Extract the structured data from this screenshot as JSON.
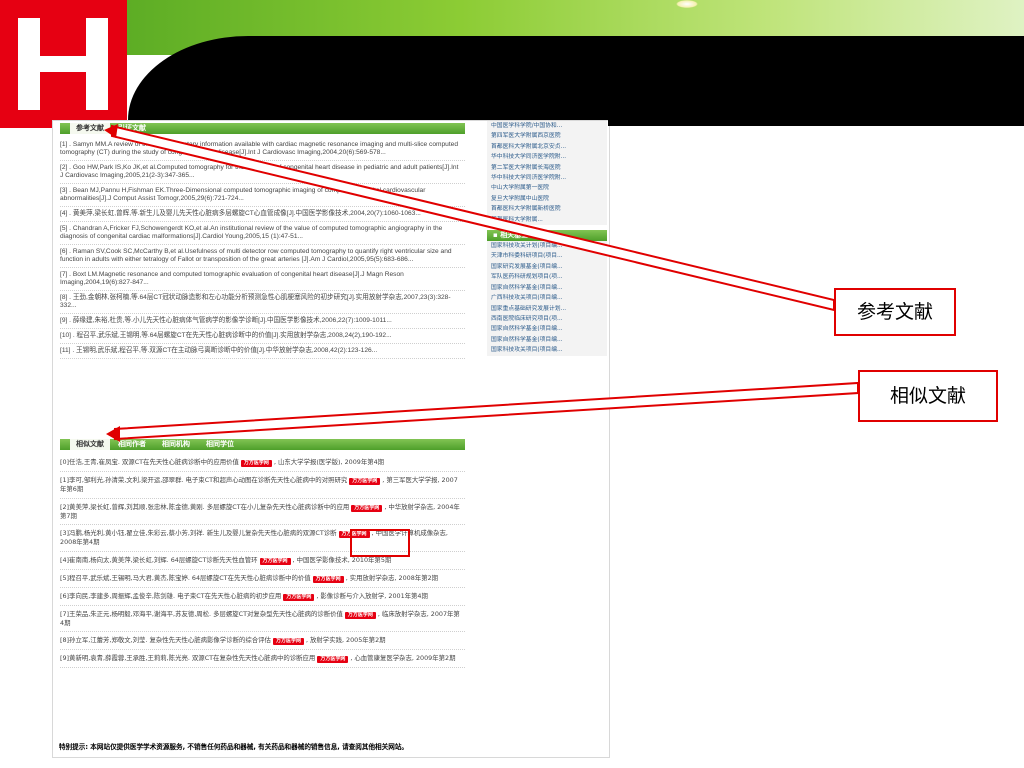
{
  "callouts": {
    "references": "参考文献",
    "similar": "相似文献"
  },
  "tabs_top": {
    "active": "参考文献",
    "other": "引证文献"
  },
  "tabs_bottom": {
    "active": "相似文献",
    "second": "相同作者",
    "third": "相同机构",
    "fourth": "相同学位"
  },
  "references": [
    "[1] . Samyn MM.A review of the complementary information available with cardiac magnetic resonance imaging and multi-slice computed tomography (CT) during the study of congenital heart disease[J].Int J Cardiovasc Imaging,2004,20(6):569-578...",
    "[2] . Goo HW,Park IS,Ko JK,et al.Computed tomography for the diagnosis of congenital heart disease in pediatric and adult patients[J].Int J Cardiovasc Imaging,2005,21(2-3):347-365...",
    "[3] . Bean MJ,Pannu H,Fishman EK.Three-Dimensional computed tomographic imaging of complex congenital cardiovascular abnormalities[J].J Comput Assist Tomogr,2005,29(6):721-724...",
    "[4] . 黄美萍,梁长虹,曾辉,等.新生儿及婴儿先天性心脏病多层螺旋CT心血管成像[J].中国医学影像技术,2004,20(7):1060-1063...",
    "[5] . Chandran A,Fricker FJ,Schowengerdt KO,et al.An institutional review of the value of computed tomographic angiography in the diagnosis of congenital cardiac malformations[J].Cardiol Young,2005,15 (1):47-51...",
    "[6] . Raman SV,Cook SC,McCarthy B,et al.Usefulness of multi detector row computed tomography to quantify right ventricular size and function in adults with either tetralogy of Fallot or transposition of the great arteries [J].Am J Cardiol,2005,95(5):683-686...",
    "[7] . Boxt LM.Magnetic resonance and computed tomographic evaluation of congenital heart disease[J].J Magn Reson Imaging,2004,19(6):827-847...",
    "[8] . 王劲,金朝林,张柯楠,等.64层CT冠状动脉造影和左心功能分析预测急性心肌梗塞风险的初步研究[J].实用放射学杂志,2007,23(3):328-332...",
    "[9] . 薛缘建,朱裕,杜贵,等.小儿先天性心脏病体气管病学的影像学诊断[J].中国医学影像技术,2006,22(7):1009-1011...",
    "[10] . 程召平,武乐斌,王锡明,等.64层螺旋CT在先天性心脏病诊断中的价值[J].实用放射学杂志,2008,24(2),190-192...",
    "[11] . 王锡明,武乐斌,程召平,等.双源CT在主动脉弓离断诊断中的价值[J].中华放射学杂志,2008,42(2):123-126..."
  ],
  "similar": [
    {
      "text": "[0]任浩,王青,崔凤宝. 双源CT在先天性心脏病诊断中的应用价值",
      "tail": ", 山东大学学报(医学版), 2009年第4期"
    },
    {
      "text": "[1]李可,邹利光,孙清荣,文利,梁开运,邵翠群. 电子束CT和超声心动图在诊断先天性心脏病中的对照研究",
      "tail": ", 第三军医大学学报, 2007年第6期"
    },
    {
      "text": "[2]黄美萍,梁长虹,曾辉,刘其顺,张忠林,陈金德,黄刚. 多层螺旋CT在小儿复杂先天性心脏病诊断中的应用",
      "tail": ", 中华放射学杂志, 2004年第7期"
    },
    {
      "text": "[3]冯鹏,杨光利,黄小钰,翟立佳,朱彩云,蔡小芳,刘祥. 新生儿及婴儿复杂先天性心脏病的双源CT诊断",
      "tail": ", 中国医学计算机成像杂志, 2008年第4期"
    },
    {
      "text": "[4]崔南南,杨向太,黄美萍,梁长虹,刘辉. 64层螺旋CT诊断先天性血管环",
      "tail": ", 中国医学影像技术, 2010年第5期"
    },
    {
      "text": "[5]程召平,武乐斌,王锡明,马大君,黄杰,陈宝婷. 64层螺旋CT在先天性心脏病诊断中的价值",
      "tail": ", 实用放射学杂志, 2008年第2期"
    },
    {
      "text": "[6]李向民,李建多,周振辉,孟俊辛,陈剑雄. 电子束CT在先天性心脏病的初步应用",
      "tail": ", 影像诊断与介入放射学, 2001年第4期"
    },
    {
      "text": "[7]王荣品,朱正元,杨明毅,邓海平,谢海平,苏友德,周松. 多层螺旋CT对复杂型先天性心脏病的诊断价值",
      "tail": ", 临床放射学杂志, 2007年第4期"
    },
    {
      "text": "[8]孙立军,江蕾芳,郑敬文,刘莹. 复杂性先天性心脏病影像学诊断的综合评估",
      "tail": ", 放射学实践, 2005年第2期"
    },
    {
      "text": "[9]黄新明,袁青,薛霞蓉,王承胜,王莉莉,陈光亮. 双源CT在复杂性先天性心脏病中的诊断应用",
      "tail": ", 心血管康复医学杂志, 2009年第2期"
    }
  ],
  "wanfang_badge": "万方医学网",
  "sidebar": {
    "institutions": [
      "中国医学科学院/中国协和...",
      "第四军医大学附属西京医院",
      "首都医科大学附属北京安贞...",
      "华中科技大学同济医学院附...",
      "第二军医大学附属长海医院",
      "华中科技大学同济医学院附...",
      "中山大学附属第一医院",
      "复旦大学附属中山医院",
      "首都医科大学附属新桥医院",
      "首都医科大学附属..."
    ],
    "fund_title": "相关基金",
    "funds": [
      "国家科技攻关计划(项目编...",
      "天津市科委科研项目(项目...",
      "国家研究发展基金(项目编...",
      "军队医药科研规划项目(项...",
      "国家自然科学基金(项目编...",
      "广西科技攻关项目(项目编...",
      "国家重点基础研究发展计划...",
      "西南医院临床研究项目(项...",
      "国家自然科学基金(项目编...",
      "国家自然科学基金(项目编...",
      "国家科技攻关项目(项目编..."
    ]
  },
  "footer_note": "特别提示: 本网站仅提供医学学术资源服务, 不销售任何药品和器械, 有关药品和器械的销售信息, 请查阅其他相关网站。",
  "colors": {
    "accent_red": "#e00000",
    "tab_green": "#4e9f2a",
    "logo_red": "#e60012"
  }
}
